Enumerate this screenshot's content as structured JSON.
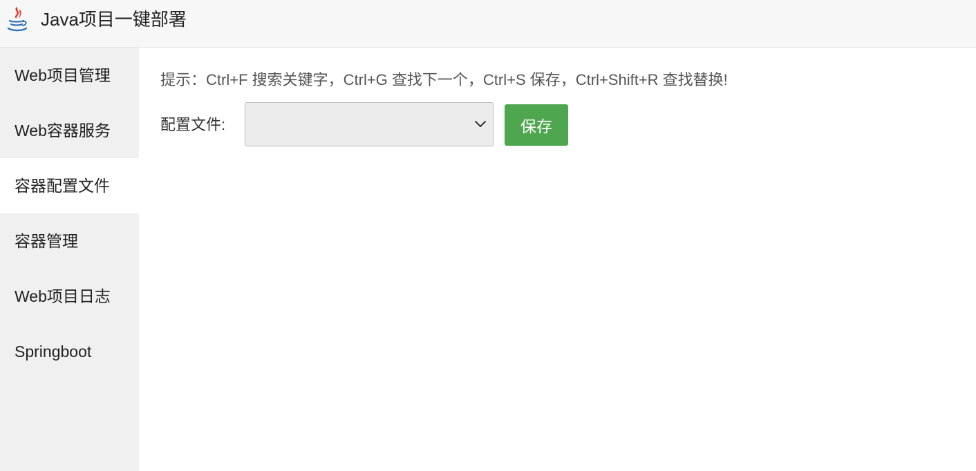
{
  "header": {
    "logo_icon": "java-coffee-cup-icon",
    "title": "Java项目一键部署"
  },
  "sidebar": {
    "items": [
      {
        "label": "Web项目管理",
        "active": false
      },
      {
        "label": "Web容器服务",
        "active": false
      },
      {
        "label": "容器配置文件",
        "active": true
      },
      {
        "label": "容器管理",
        "active": false
      },
      {
        "label": "Web项目日志",
        "active": false
      },
      {
        "label": "Springboot",
        "active": false
      }
    ]
  },
  "main": {
    "hint": "提示：Ctrl+F 搜索关键字，Ctrl+G 查找下一个，Ctrl+S 保存，Ctrl+Shift+R 查找替换!",
    "config_label": "配置文件:",
    "config_select_value": "",
    "save_label": "保存"
  },
  "colors": {
    "save_button": "#4ea64f",
    "sidebar_bg": "#f0f0f0",
    "header_bg": "#f7f7f7",
    "active_item_bg": "#ffffff"
  }
}
